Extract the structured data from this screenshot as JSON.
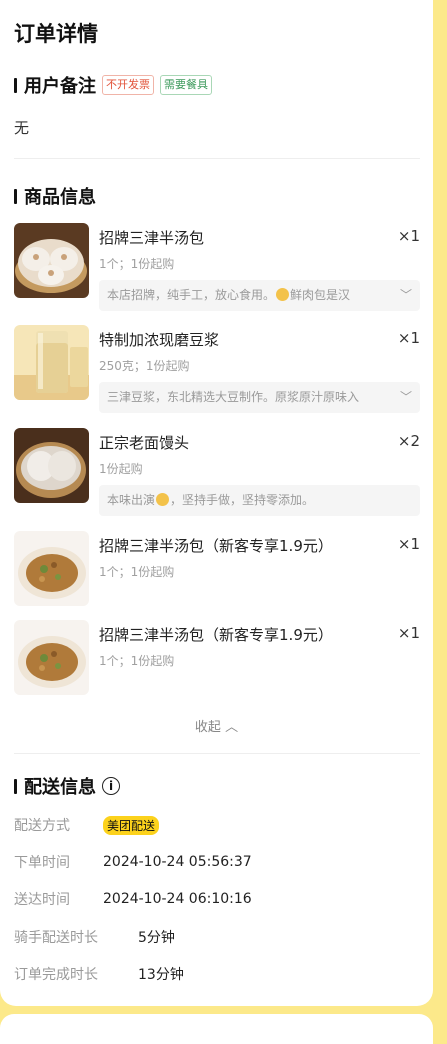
{
  "page_title": "订单详情",
  "remark": {
    "title": "用户备注",
    "tags": [
      "不开发票",
      "需要餐具"
    ],
    "text": "无"
  },
  "goods": {
    "title": "商品信息",
    "items": [
      {
        "name": "招牌三津半汤包",
        "qty": "×1",
        "spec": "1个；1份起购",
        "desc": "本店招牌，纯手工，放心食用。",
        "desc_tail": "鲜肉包是汉",
        "image": "steamed-bun-basket"
      },
      {
        "name": "特制加浓现磨豆浆",
        "qty": "×1",
        "spec": "250克；1份起购",
        "desc": "三津豆浆，东北精选大豆制作。原浆原汁原味入",
        "desc_tail": "",
        "image": "soy-milk-glass"
      },
      {
        "name": "正宗老面馒头",
        "qty": "×2",
        "spec": "1份起购",
        "desc": "本味出演",
        "desc_tail": "，坚持手做，坚持零添加。",
        "image": "mantou-basket"
      },
      {
        "name": "招牌三津半汤包（新客专享1.9元）",
        "qty": "×1",
        "spec": "1个；1份起购",
        "desc": "",
        "desc_tail": "",
        "image": "cut-bun-1"
      },
      {
        "name": "招牌三津半汤包（新客专享1.9元）",
        "qty": "×1",
        "spec": "1个；1份起购",
        "desc": "",
        "desc_tail": "",
        "image": "cut-bun-2"
      }
    ],
    "collapse_label": "收起"
  },
  "delivery": {
    "title": "配送信息",
    "rows": [
      {
        "label": "配送方式",
        "value": "美团配送"
      },
      {
        "label": "下单时间",
        "value": "2024-10-24 05:56:37"
      },
      {
        "label": "送达时间",
        "value": "2024-10-24 06:10:16"
      },
      {
        "label": "骑手配送时长",
        "value": "5分钟"
      },
      {
        "label": "订单完成时长",
        "value": "13分钟"
      }
    ]
  },
  "colors": {
    "background": "#fce98a",
    "badge": "#fcd21c",
    "tag_red": "#e2533a",
    "tag_green": "#3d9a5c"
  }
}
